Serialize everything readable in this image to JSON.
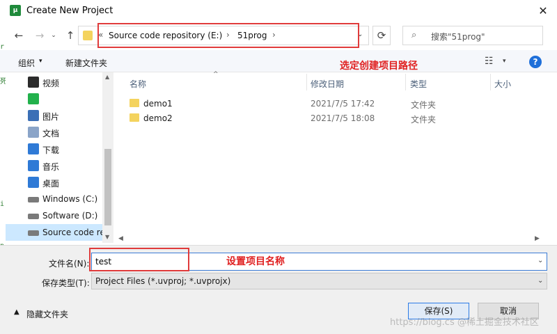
{
  "window": {
    "title": "Create New Project",
    "app_icon_text": "μ",
    "close_glyph": "✕"
  },
  "nav": {
    "back": "←",
    "forward": "→",
    "recent": "⌄",
    "up": "↑",
    "refresh": "⟳"
  },
  "address": {
    "separator": "«",
    "crumbs": [
      "Source code repository (E:)",
      "51prog"
    ],
    "crumb_sep": "›",
    "dropdown": "⌄"
  },
  "search": {
    "placeholder": "搜索\"51prog\"",
    "icon": "⌕"
  },
  "toolbar": {
    "organize_label": "组织",
    "organize_caret": "▾",
    "new_folder_label": "新建文件夹",
    "view_icon": "☷",
    "view_caret": "▾",
    "help_label": "?"
  },
  "annotations": {
    "path_note": "选定创建项目路径",
    "name_note": "设置项目名称"
  },
  "sidebar": {
    "items": [
      {
        "label": "视频",
        "icon": "video-icon",
        "color": "#2b2b2b"
      },
      {
        "label": "",
        "icon": "wechat-icon",
        "color": "#22b14c"
      },
      {
        "label": "图片",
        "icon": "pictures-icon",
        "color": "#3b6fb6"
      },
      {
        "label": "文档",
        "icon": "documents-icon",
        "color": "#8aa4c8"
      },
      {
        "label": "下载",
        "icon": "downloads-icon",
        "color": "#2f7ad6"
      },
      {
        "label": "音乐",
        "icon": "music-icon",
        "color": "#2f7ad6"
      },
      {
        "label": "桌面",
        "icon": "desktop-icon",
        "color": "#2f7ad6"
      },
      {
        "label": "Windows (C:)",
        "icon": "drive-icon",
        "color": "#7a7a7a"
      },
      {
        "label": "Software (D:)",
        "icon": "drive-icon",
        "color": "#7a7a7a"
      },
      {
        "label": "Source code re",
        "icon": "drive-icon",
        "color": "#7a7a7a"
      }
    ],
    "scroll_up": "▲",
    "scroll_down": "▼"
  },
  "filelist": {
    "sort_caret": "^",
    "columns": [
      "名称",
      "修改日期",
      "类型",
      "大小"
    ],
    "rows": [
      {
        "name": "demo1",
        "date": "2021/7/5 17:42",
        "type": "文件夹"
      },
      {
        "name": "demo2",
        "date": "2021/7/5 18:08",
        "type": "文件夹"
      }
    ],
    "hscroll_left": "◀",
    "hscroll_right": "▶"
  },
  "form": {
    "filename_label": "文件名(N):",
    "filename_value": "test",
    "filename_caret": "⌄",
    "filetype_label": "保存类型(T):",
    "filetype_value": "Project Files (*.uvproj; *.uvprojx)",
    "filetype_caret": "⌄"
  },
  "footer": {
    "hide_folders_label": "隐藏文件夹",
    "hide_caret": "▲",
    "save_label": "保存(S)",
    "cancel_label": "取消"
  },
  "watermark": "https://blog.cs @稀土掘金技术社区"
}
